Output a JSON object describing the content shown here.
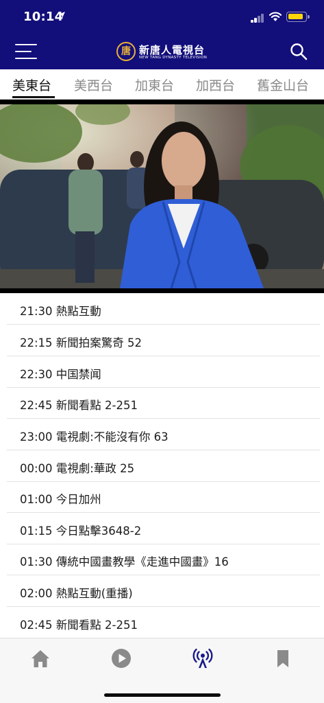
{
  "status_bar": {
    "time": "10:14"
  },
  "header": {
    "logo_mark": "唐",
    "logo_cn": "新唐人電視台",
    "logo_en": "NEW TANG DYNASTY TELEVISION"
  },
  "tabs": [
    {
      "label": "美東台",
      "active": true
    },
    {
      "label": "美西台",
      "active": false
    },
    {
      "label": "加東台",
      "active": false
    },
    {
      "label": "加西台",
      "active": false
    },
    {
      "label": "舊金山台",
      "active": false
    }
  ],
  "schedule": [
    {
      "text": "21:30 熱點互動"
    },
    {
      "text": "22:15 新聞拍案驚奇 52"
    },
    {
      "text": "22:30 中国禁闻"
    },
    {
      "text": "22:45 新聞看點 2-251"
    },
    {
      "text": "23:00 電視劇:不能沒有你 63"
    },
    {
      "text": "00:00 電視劇:華政 25"
    },
    {
      "text": "01:00 今日加州"
    },
    {
      "text": "01:15 今日點擊3648-2"
    },
    {
      "text": "01:30 傳統中國畫教學《走進中國畫》16"
    },
    {
      "text": "02:00 熱點互動(重播)"
    },
    {
      "text": "02:45 新聞看點 2-251"
    }
  ],
  "bottom_nav": [
    {
      "icon": "home-icon",
      "active": false
    },
    {
      "icon": "play-icon",
      "active": false
    },
    {
      "icon": "live-broadcast-icon",
      "active": true
    },
    {
      "icon": "bookmark-icon",
      "active": false
    }
  ],
  "colors": {
    "header_bg": "#120e7a",
    "logo_gold": "#e8b13a",
    "nav_active": "#1a1a8a",
    "nav_inactive": "#8a8a8a",
    "battery": "#ffd60a"
  }
}
